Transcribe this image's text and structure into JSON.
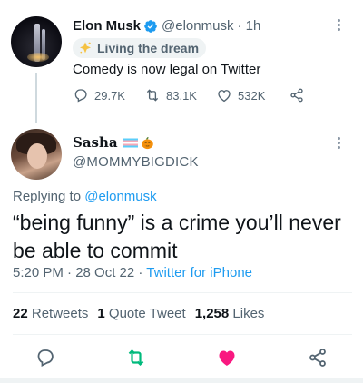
{
  "parent_tweet": {
    "author_name": "Elon Musk",
    "handle": "@elonmusk",
    "time": "· 1h",
    "badge_label": "Living the dream",
    "text": "Comedy is now legal on Twitter",
    "replies": "29.7K",
    "retweets": "83.1K",
    "likes": "532K"
  },
  "reply_tweet": {
    "author_name": "Sasha",
    "handle": "@MOMMYBIGDICK",
    "replying_prefix": "Replying to ",
    "replying_handle": "@elonmusk",
    "text": "“being funny” is a crime you’ll never be able to commit",
    "time": "5:20 PM · 28 Oct 22 · ",
    "source": "Twitter for iPhone",
    "retweet_count": "22",
    "retweet_label": "Retweets",
    "quote_count": "1",
    "quote_label": "Quote Tweet",
    "like_count": "1,258",
    "like_label": "Likes"
  },
  "icons": {
    "verified": "verified-badge-icon",
    "more": "more-icon",
    "reply": "reply-icon",
    "retweet": "retweet-icon",
    "like": "heart-icon",
    "share": "share-icon",
    "flag": "trans-flag-icon",
    "pumpkin": "pumpkin-icon",
    "star": "sparkle-star-icon"
  },
  "colors": {
    "accent": "#1d9bf0",
    "retweet_active": "#00ba7c",
    "like_active": "#f91880",
    "secondary_text": "#536471"
  }
}
